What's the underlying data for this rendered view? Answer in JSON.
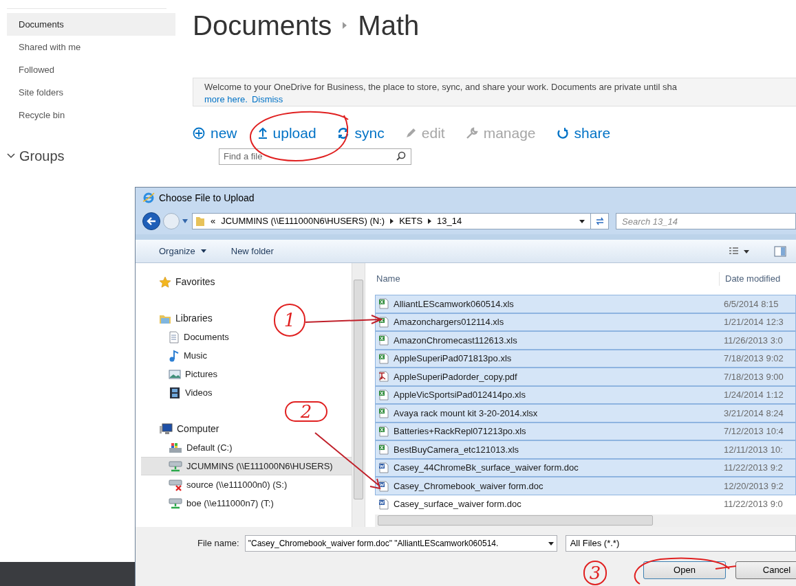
{
  "sidebar": {
    "items": [
      {
        "label": "Documents",
        "selected": true
      },
      {
        "label": "Shared with me",
        "selected": false
      },
      {
        "label": "Followed",
        "selected": false
      },
      {
        "label": "Site folders",
        "selected": false
      },
      {
        "label": "Recycle bin",
        "selected": false
      }
    ],
    "groups": {
      "label": "Groups",
      "expanded": true
    }
  },
  "breadcrumb": [
    "Documents",
    "Math"
  ],
  "banner": {
    "text": "Welcome to your OneDrive for Business, the place to store, sync, and share your work. Documents are private until sha",
    "links": [
      "more here.",
      "Dismiss"
    ]
  },
  "toolbar": [
    {
      "kind": "new",
      "label": "new",
      "disabled": false
    },
    {
      "kind": "upload",
      "label": "upload",
      "disabled": false
    },
    {
      "kind": "sync",
      "label": "sync",
      "disabled": false
    },
    {
      "kind": "edit",
      "label": "edit",
      "disabled": true
    },
    {
      "kind": "manage",
      "label": "manage",
      "disabled": true
    },
    {
      "kind": "share",
      "label": "share",
      "disabled": false
    }
  ],
  "find": {
    "placeholder": "Find a file"
  },
  "dialog": {
    "title": "Choose File to Upload",
    "address": [
      "«",
      "JCUMMINS (\\\\E111000N6\\HUSERS) (N:)",
      "KETS",
      "13_14"
    ],
    "search": {
      "placeholder": "Search 13_14"
    },
    "commands": [
      "Organize",
      "New folder"
    ],
    "nav": [
      {
        "kind": "favorites",
        "label": "Favorites",
        "selected": false
      },
      {
        "kind": "libraries",
        "label": "Libraries",
        "selected": false,
        "children": [
          {
            "kind": "documents",
            "label": "Documents",
            "selected": false
          },
          {
            "kind": "music",
            "label": "Music",
            "selected": false
          },
          {
            "kind": "pictures",
            "label": "Pictures",
            "selected": false
          },
          {
            "kind": "videos",
            "label": "Videos",
            "selected": false
          }
        ]
      },
      {
        "kind": "computer",
        "label": "Computer",
        "selected": false,
        "children": [
          {
            "kind": "drive",
            "label": "Default (C:)",
            "selected": false
          },
          {
            "kind": "network",
            "label": "JCUMMINS (\\\\E111000N6\\HUSERS)",
            "selected": true
          },
          {
            "kind": "network-off",
            "label": "source (\\\\e111000n0) (S:)",
            "selected": false
          },
          {
            "kind": "network",
            "label": "boe (\\\\e111000n7) (T:)",
            "selected": false
          }
        ]
      }
    ],
    "columns": [
      "Name",
      "Date modified"
    ],
    "files": [
      {
        "kind": "xls",
        "name": "AlliantLEScamwork060514.xls",
        "date": "6/5/2014 8:15",
        "selected": true
      },
      {
        "kind": "xls",
        "name": "Amazonchargers012114.xls",
        "date": "1/21/2014 12:3",
        "selected": true
      },
      {
        "kind": "xls",
        "name": "AmazonChromecast112613.xls",
        "date": "11/26/2013 3:0",
        "selected": true
      },
      {
        "kind": "xls",
        "name": "AppleSuperiPad071813po.xls",
        "date": "7/18/2013 9:02",
        "selected": true
      },
      {
        "kind": "pdf",
        "name": "AppleSuperiPadorder_copy.pdf",
        "date": "7/18/2013 9:00",
        "selected": true
      },
      {
        "kind": "xls",
        "name": "AppleVicSportsiPad012414po.xls",
        "date": "1/24/2014 1:12",
        "selected": true
      },
      {
        "kind": "xls",
        "name": "Avaya rack mount kit 3-20-2014.xlsx",
        "date": "3/21/2014 8:24",
        "selected": true
      },
      {
        "kind": "xls",
        "name": "Batteries+RackRepl071213po.xls",
        "date": "7/12/2013 10:4",
        "selected": true
      },
      {
        "kind": "xls",
        "name": "BestBuyCamera_etc121013.xls",
        "date": "12/11/2013 10:",
        "selected": true
      },
      {
        "kind": "doc",
        "name": "Casey_44ChromeBk_surface_waiver form.doc",
        "date": "11/22/2013 9:2",
        "selected": true
      },
      {
        "kind": "doc",
        "name": "Casey_Chromebook_waiver form.doc",
        "date": "12/20/2013 9:2",
        "selected": true
      },
      {
        "kind": "doc",
        "name": "Casey_surface_waiver form.doc",
        "date": "11/22/2013 9:0",
        "selected": false
      }
    ],
    "file_name_label": "File name:",
    "file_name": "\"Casey_Chromebook_waiver form.doc\" \"AlliantLEScamwork060514.",
    "filter": "All Files (*.*)",
    "buttons": [
      "Open",
      "Cancel"
    ]
  },
  "annotations": [
    "1",
    "2",
    "3"
  ]
}
